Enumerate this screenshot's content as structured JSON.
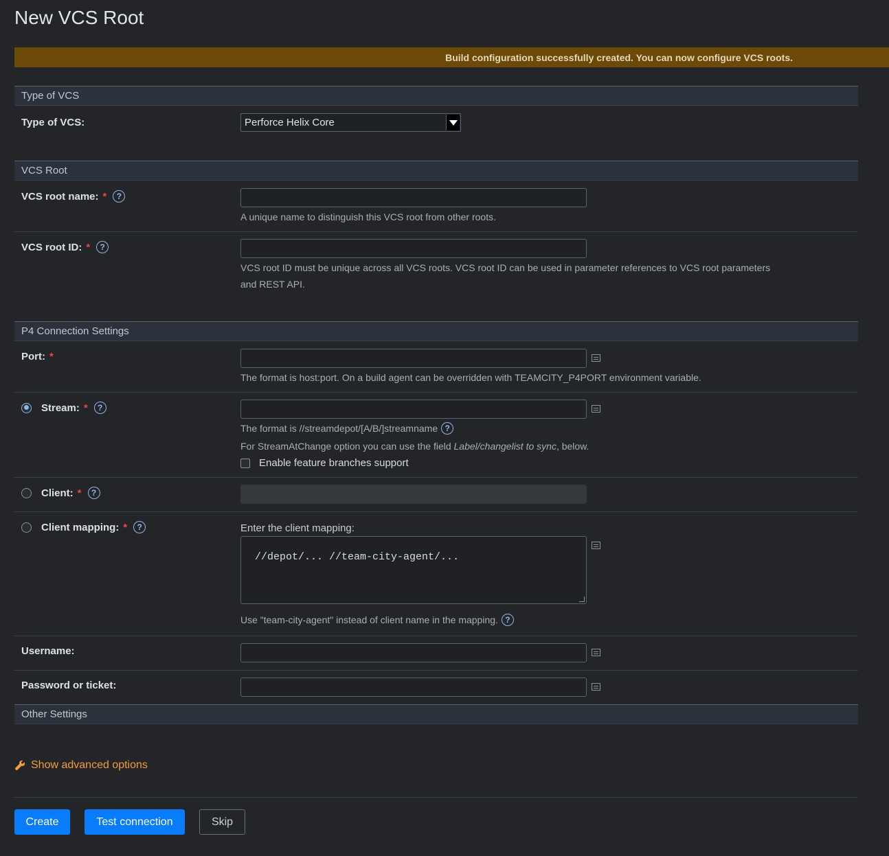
{
  "page": {
    "title": "New VCS Root"
  },
  "banner": {
    "message": "Build configuration successfully created. You can now configure VCS roots."
  },
  "sections": {
    "type_of_vcs": "Type of VCS",
    "vcs_root": "VCS Root",
    "p4_connection": "P4 Connection Settings",
    "other": "Other Settings"
  },
  "type_of_vcs": {
    "label": "Type of VCS:",
    "selected": "Perforce Helix Core"
  },
  "vcs_root_name": {
    "label": "VCS root name:",
    "value": "",
    "note": "A unique name to distinguish this VCS root from other roots."
  },
  "vcs_root_id": {
    "label": "VCS root ID:",
    "value": "",
    "note_line1": "VCS root ID must be unique across all VCS roots. VCS root ID can be used in parameter references to VCS root parameters",
    "note_line2": "and REST API."
  },
  "port": {
    "label": "Port:",
    "value": "",
    "note": "The format is host:port. On a build agent can be overridden with TEAMCITY_P4PORT environment variable."
  },
  "stream": {
    "label": "Stream:",
    "value": "",
    "note_format": "The format is //streamdepot/[A/B/]streamname",
    "note_change_prefix": "For StreamAtChange option you can use the field ",
    "note_change_italic": "Label/changelist to sync",
    "note_change_suffix": ", below.",
    "feature_branches_label": "Enable feature branches support"
  },
  "client": {
    "label": "Client:",
    "value": ""
  },
  "client_mapping": {
    "label": "Client mapping:",
    "prompt": "Enter the client mapping:",
    "value": "//depot/... //team-city-agent/...",
    "note": "Use \"team-city-agent\" instead of client name in the mapping."
  },
  "username": {
    "label": "Username:",
    "value": ""
  },
  "password": {
    "label": "Password or ticket:",
    "value": ""
  },
  "advanced": {
    "label": "Show advanced options"
  },
  "buttons": {
    "create": "Create",
    "test": "Test connection",
    "skip": "Skip"
  },
  "required_mark": "*",
  "help_mark": "?"
}
